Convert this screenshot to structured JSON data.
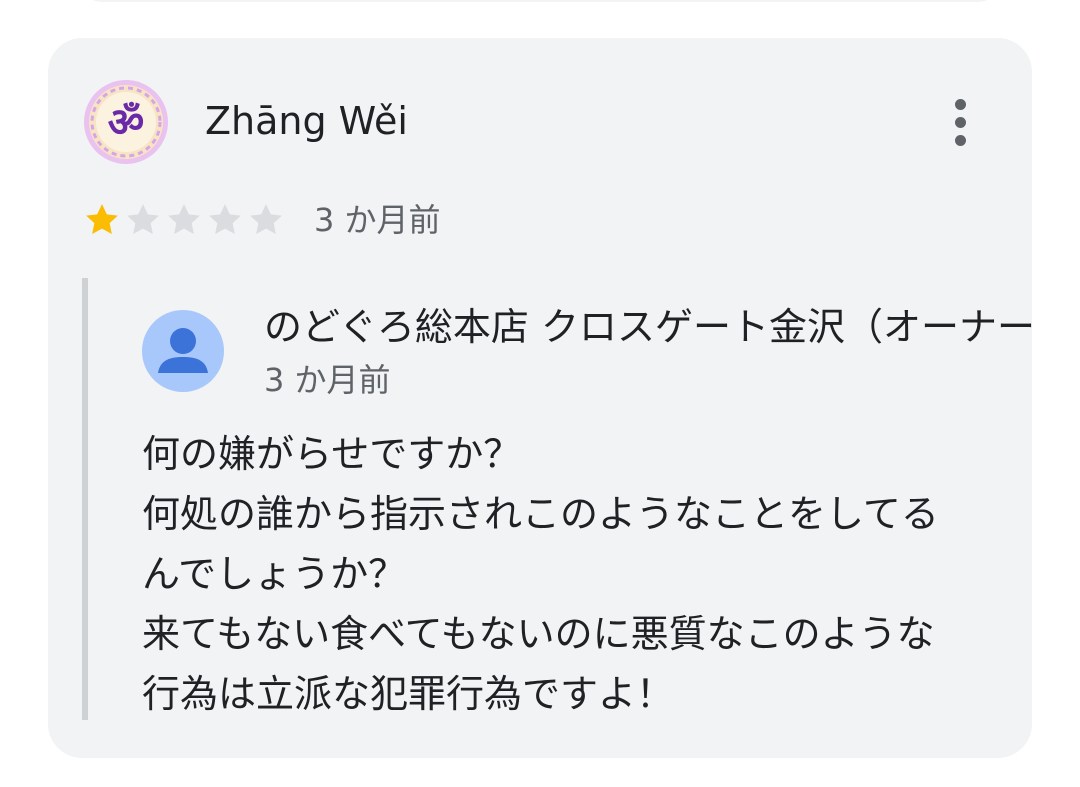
{
  "review": {
    "author_name": "Zhāng Wěi",
    "author_avatar": "om-symbol-avatar",
    "more_icon": "more-vert-icon",
    "rating": 1,
    "max_rating": 5,
    "time": "3 か月前",
    "colors": {
      "card_background": "#f1f3f4",
      "star_filled": "#fbbc04",
      "star_empty": "#dadce0",
      "avatar_purple": "#6a2aa8",
      "avatar_ring": "#e9c2f0"
    }
  },
  "owner_reply": {
    "name": "のどぐろ総本店 クロスゲート金沢（オーナー）",
    "time": "3 か月前",
    "avatar_icon": "person-icon",
    "avatar_colors": {
      "background": "#a8c7fa",
      "figure": "#3b73d9"
    },
    "lines": [
      "何の嫌がらせですか？",
      "何処の誰から指示されこのようなことをしてる",
      "んでしょうか？",
      "来てもない食べてもないのに悪質なこのような",
      "行為は立派な犯罪行為ですよ！"
    ]
  }
}
